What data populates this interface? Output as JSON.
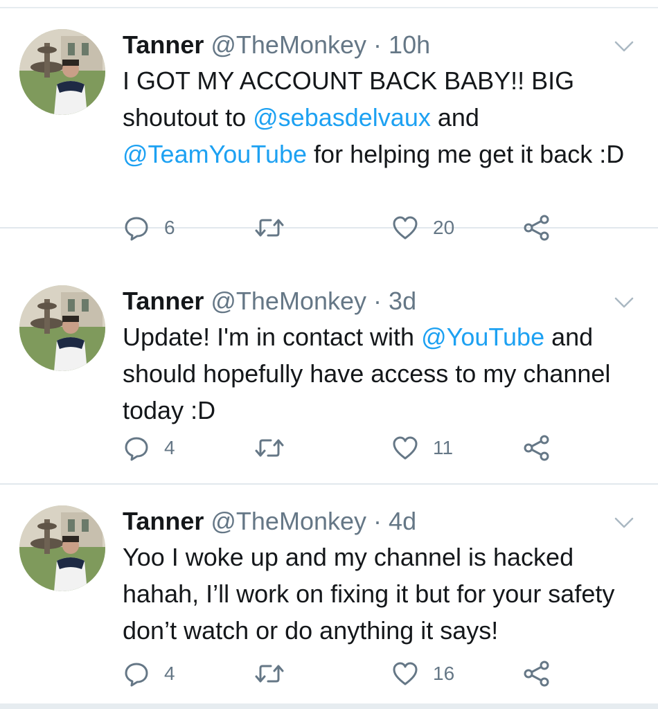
{
  "colors": {
    "link": "#1da1f2",
    "muted": "#657786",
    "text": "#14171a",
    "divider": "#e1e8ed"
  },
  "tweets": [
    {
      "name": "Tanner",
      "handle": "@TheMonkey",
      "separator": "·",
      "time": "10h",
      "body": [
        {
          "text": "I GOT MY ACCOUNT BACK BABY!! BIG shoutout to ",
          "mention": false
        },
        {
          "text": "@sebasdelvaux",
          "mention": true
        },
        {
          "text": " and ",
          "mention": false
        },
        {
          "text": "@TeamYouTube",
          "mention": true
        },
        {
          "text": " for helping me get it back :D",
          "mention": false
        }
      ],
      "replies": "6",
      "retweets": "",
      "likes": "20"
    },
    {
      "name": "Tanner",
      "handle": "@TheMonkey",
      "separator": "·",
      "time": "3d",
      "body": [
        {
          "text": "Update! I'm in contact with ",
          "mention": false
        },
        {
          "text": "@YouTube",
          "mention": true
        },
        {
          "text": " and should hopefully have access to my channel today :D",
          "mention": false
        }
      ],
      "replies": "4",
      "retweets": "",
      "likes": "11"
    },
    {
      "name": "Tanner",
      "handle": "@TheMonkey",
      "separator": "·",
      "time": "4d",
      "body": [
        {
          "text": "Yoo I woke up and my channel is hacked hahah, I’ll work on fixing it but for your safety don’t watch or do anything it says!",
          "mention": false
        }
      ],
      "replies": "4",
      "retweets": "",
      "likes": "16"
    }
  ],
  "icons": {
    "reply": "reply-icon",
    "retweet": "retweet-icon",
    "like": "heart-icon",
    "share": "share-icon",
    "caret": "chevron-down-icon"
  }
}
